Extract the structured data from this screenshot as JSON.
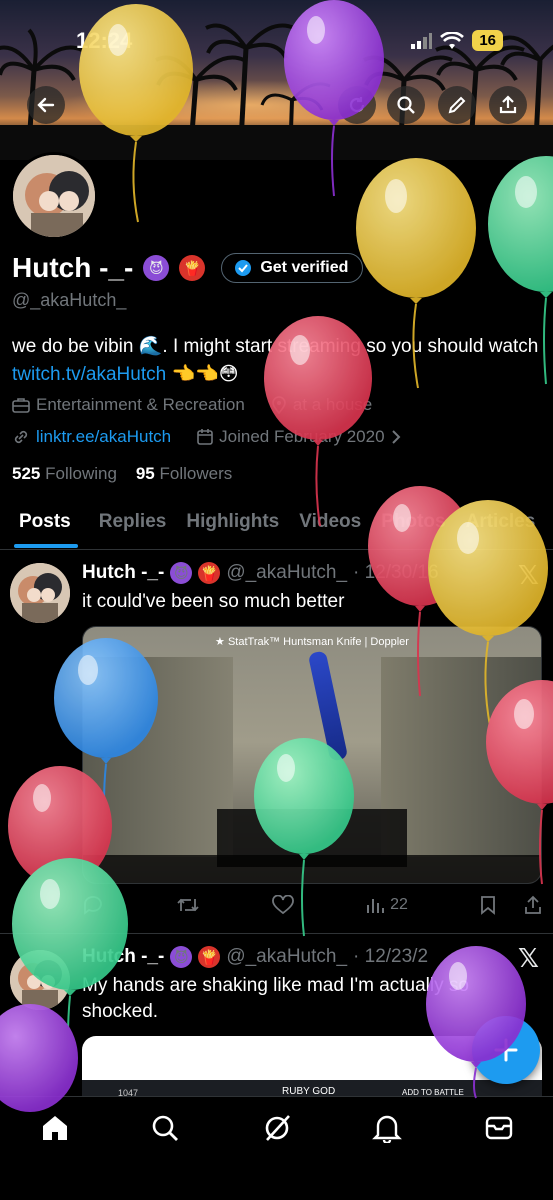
{
  "status_bar": {
    "time": "12:24",
    "battery": "16"
  },
  "profile": {
    "name": "Hutch -_-",
    "get_verified_label": "Get verified",
    "handle": "@_akaHutch_",
    "bio_prefix": "we do be vibin 🌊. I might start streaming so you should watch ",
    "bio_link": "twitch.tv/akaHutch",
    "bio_suffix": " 👈👈😳",
    "category": "Entertainment & Recreation",
    "location": "at a house",
    "website": "linktr.ee/akaHutch",
    "joined": "Joined February 2020",
    "following_count": "525",
    "following_label": "Following",
    "followers_count": "95",
    "followers_label": "Followers"
  },
  "tabs": [
    "Posts",
    "Replies",
    "Highlights",
    "Videos",
    "Photos",
    "Articles"
  ],
  "tweets": [
    {
      "name": "Hutch -_-",
      "handle": "@_akaHutch_",
      "date": "· 12/30/16",
      "text": "it could've been so much better",
      "media_title": "★ StatTrak™ Huntsman Knife | Doppler",
      "views": "22"
    },
    {
      "name": "Hutch -_-",
      "handle": "@_akaHutch_",
      "date": "· 12/23/2",
      "text": "My hands are shaking like mad I'm actually so shocked.",
      "media_caption": "RUBY GOD",
      "media_count": "1047",
      "media_button": "ADD TO BATTLE"
    }
  ],
  "colors": {
    "accent": "#1d9bf0",
    "background": "#000000",
    "muted": "#71767b"
  },
  "icons": [
    "back-arrow-icon",
    "refresh-icon",
    "search-icon",
    "edit-icon",
    "share-icon",
    "verified-badge-icon",
    "briefcase-icon",
    "location-icon",
    "link-icon",
    "calendar-icon",
    "x-logo-icon",
    "retweet-icon",
    "like-icon",
    "views-icon",
    "bookmark-icon",
    "compose-plus-icon",
    "home-icon",
    "grok-icon",
    "bell-icon",
    "mail-icon"
  ]
}
